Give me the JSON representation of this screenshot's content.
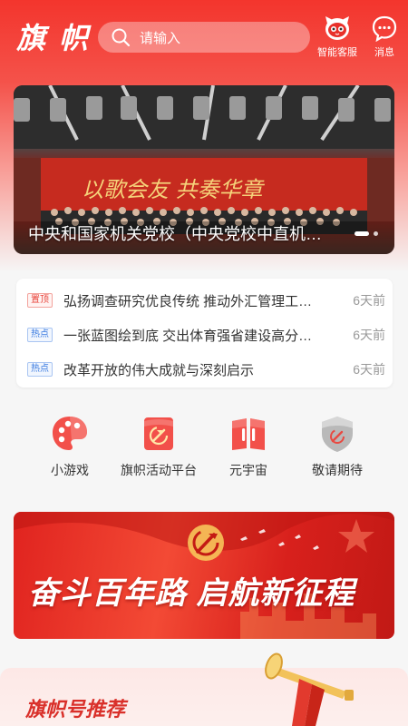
{
  "header": {
    "logo_text": "旗 帜",
    "search_placeholder": "请输入",
    "service_label": "智能客服",
    "message_label": "消息"
  },
  "banner": {
    "title": "中央和国家机关党校（中央党校中直机关分校）",
    "backdrop_text": "以歌会友 共奏华章",
    "slide_count": 2,
    "active_slide": 1
  },
  "news": [
    {
      "tag": "置顶",
      "tag_type": "top",
      "title": "弘扬调查研究优良传统 推动外汇管理工作高质量发展",
      "time": "6天前"
    },
    {
      "tag": "热点",
      "tag_type": "hot",
      "title": "一张蓝图绘到底 交出体育强省建设高分答卷",
      "time": "6天前"
    },
    {
      "tag": "热点",
      "tag_type": "hot",
      "title": "改革开放的伟大成就与深刻启示",
      "time": "6天前"
    }
  ],
  "menu": [
    {
      "label": "小游戏",
      "icon": "palette-icon"
    },
    {
      "label": "旗帜活动平台",
      "icon": "party-flag-icon"
    },
    {
      "label": "元宇宙",
      "icon": "book-icon"
    },
    {
      "label": "敬请期待",
      "icon": "shield-icon"
    }
  ],
  "promo": {
    "text": "奋斗百年路 启航新征程"
  },
  "recommend": {
    "title": "旗帜号推荐"
  },
  "colors": {
    "brand_red": "#f3352d",
    "tag_top": "#e8453c",
    "tag_hot": "#3b7be0"
  }
}
